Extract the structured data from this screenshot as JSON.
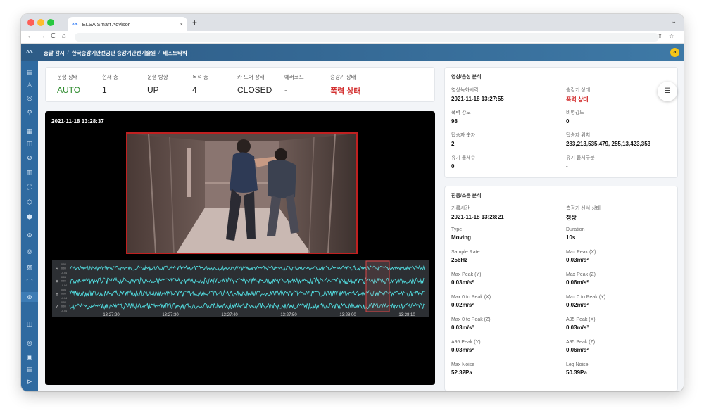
{
  "browser": {
    "tab_title": "ELSA Smart Advisor",
    "tab_close": "×",
    "new_tab": "+",
    "nav_back": "←",
    "nav_forward": "→",
    "nav_reload": "C",
    "nav_home": "⌂",
    "chevron": "⌄",
    "share_icon": "⇪",
    "star_icon": "☆",
    "favicon": "ʌʌ."
  },
  "header": {
    "logo": "ʌʌ.",
    "breadcrumb": [
      "총괄 감시",
      "한국승강기안전공단 승강기안전기술원",
      "테스트타워"
    ],
    "separator": "/",
    "user_initial": "a"
  },
  "sidebar": {
    "items": [
      "▤",
      "♙",
      "◎",
      "⚲",
      "▦",
      "◫",
      "⊘",
      "▥",
      "⛶",
      "⬡",
      "⬢",
      "⊝",
      "⦾",
      "▨",
      "⌒",
      "⊛",
      "◫",
      "⦾",
      "▣",
      "▤",
      "⊳"
    ],
    "active_index": 15
  },
  "status": {
    "run_status_label": "운행 상태",
    "run_status_value": "AUTO",
    "current_floor_label": "현재 층",
    "current_floor_value": "1",
    "direction_label": "운행 방향",
    "direction_value": "UP",
    "target_floor_label": "목적 층",
    "target_floor_value": "4",
    "door_label": "카 도어 상태",
    "door_value": "CLOSED",
    "error_label": "에러코드",
    "error_value": "-",
    "elevator_state_label": "승강기 상태",
    "elevator_state_value": "폭력 상태"
  },
  "video": {
    "timestamp": "2021-11-18 13:28:37",
    "channels": [
      "S",
      "X",
      "Y",
      "Z"
    ],
    "ytick_top": "0.04",
    "ytick_mid": "0.00",
    "ytick_bot": "-0.04",
    "time_labels": [
      "13:27:20",
      "13:27:30",
      "13:27:40",
      "13:27:50",
      "13:28:00",
      "13:28:10"
    ]
  },
  "av_analysis": {
    "title": "영상/음성 분석",
    "menu_icon": "☰",
    "fields": [
      {
        "label": "영상녹화시각",
        "value": "2021-11-18 13:27:55"
      },
      {
        "label": "승강기 상태",
        "value": "폭력 상태"
      },
      {
        "label": "폭력 강도",
        "value": "98"
      },
      {
        "label": "비명강도",
        "value": "0"
      },
      {
        "label": "탑승자 숫자",
        "value": "2"
      },
      {
        "label": "탑승자 위치",
        "value": "283,213,535,479, 255,13,423,353"
      },
      {
        "label": "유기 물체수",
        "value": "0"
      },
      {
        "label": "유기 물체구분",
        "value": "-"
      }
    ]
  },
  "vib_analysis": {
    "title": "진동/소음 분석",
    "fields": [
      {
        "label": "기록시간",
        "value": "2021-11-18 13:28:21"
      },
      {
        "label": "측정기 센서 상태",
        "value": "정상"
      },
      {
        "label": "Type",
        "value": "Moving"
      },
      {
        "label": "Duration",
        "value": "10s"
      },
      {
        "label": "Sample Rate",
        "value": "256Hz"
      },
      {
        "label": "Max Peak (X)",
        "value": "0.03m/s²"
      },
      {
        "label": "Max Peak (Y)",
        "value": "0.03m/s²"
      },
      {
        "label": "Max Peak (Z)",
        "value": "0.06m/s²"
      },
      {
        "label": "Max 0 to Peak (X)",
        "value": "0.02m/s²"
      },
      {
        "label": "Max 0 to Peak (Y)",
        "value": "0.02m/s²"
      },
      {
        "label": "Max 0 to Peak (Z)",
        "value": "0.03m/s²"
      },
      {
        "label": "A95 Peak (X)",
        "value": "0.03m/s²"
      },
      {
        "label": "A95 Peak (Y)",
        "value": "0.03m/s²"
      },
      {
        "label": "A95 Peak (Z)",
        "value": "0.06m/s²"
      },
      {
        "label": "Max Noise",
        "value": "52.32Pa"
      },
      {
        "label": "Leq Noise",
        "value": "50.39Pa"
      }
    ]
  },
  "colors": {
    "header_start": "#2d5b86",
    "header_end": "#3e79a6",
    "sidebar": "#2f6aa0",
    "alert_red": "#d32f2f",
    "ok_green": "#2e8b2e",
    "signal_cyan": "#54e5e8"
  }
}
